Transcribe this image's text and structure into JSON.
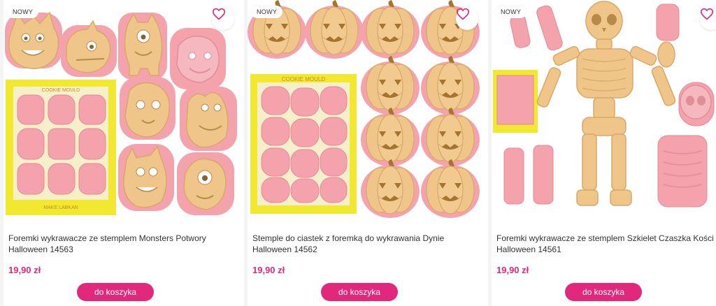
{
  "accent_color": "#e2287a",
  "products": [
    {
      "badge": "NOWY",
      "title": "Foremki wykrawacze ze stemplem Monsters Potwory Halloween 14563",
      "price": "19,90 zł",
      "button_label": "do koszyka",
      "package_label_top": "COOKIE MOULD",
      "package_label_bottom": "MAKE LABKAN",
      "favorite_icon": "heart-outline-icon"
    },
    {
      "badge": "NOWY",
      "title": "Stemple do ciastek z foremką do wykrawania Dynie Halloween 14562",
      "price": "19,90 zł",
      "button_label": "do koszyka",
      "package_label_top": "COOKIE MOULD",
      "favorite_icon": "heart-outline-icon"
    },
    {
      "badge": "NOWY",
      "title": "Foremki wykrawacze ze stemplem Szkielet Czaszka Kości Halloween 14561",
      "price": "19,90 zł",
      "button_label": "do koszyka",
      "favorite_icon": "heart-outline-icon"
    }
  ]
}
